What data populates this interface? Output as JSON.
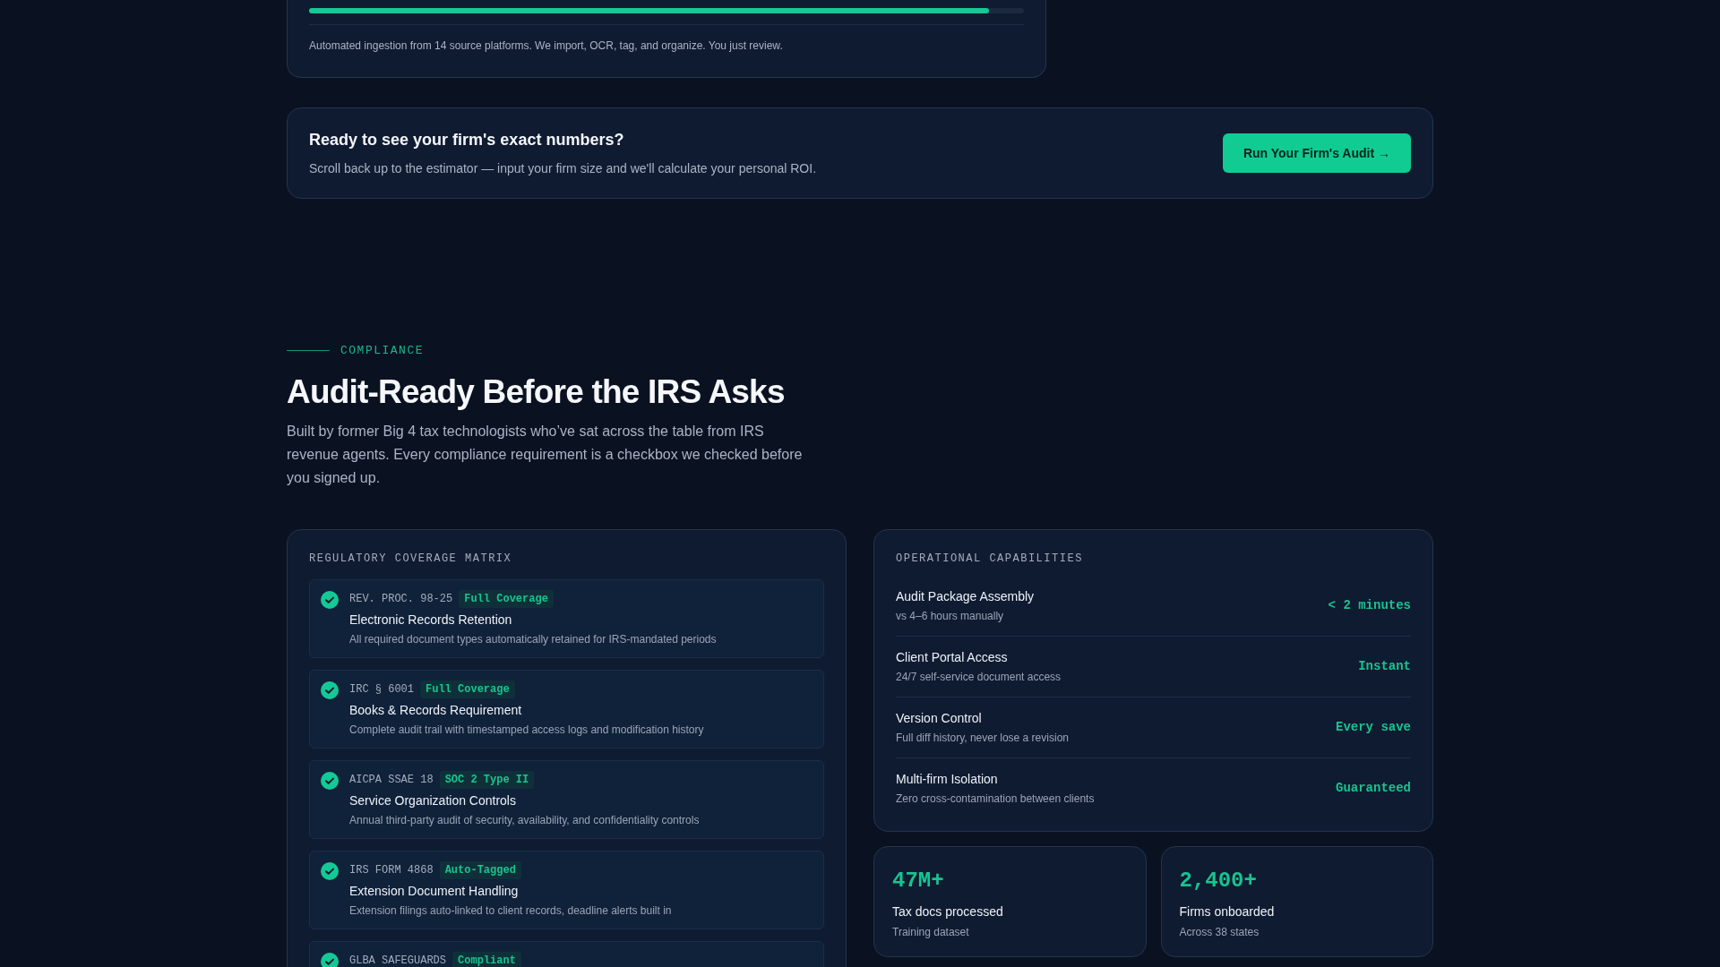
{
  "ingestion_card": {
    "progress": {
      "level": 0.951
    },
    "note": "Automated ingestion from 14 source platforms. We import, OCR, tag, and organize. You just review."
  },
  "cta": {
    "title": "Ready to see your firm's exact numbers?",
    "text": "Scroll back up to the estimator — input your firm size and we'll calculate your personal ROI.",
    "button": "Run Your Firm's Audit →"
  },
  "section": {
    "eyebrow": "COMPLIANCE",
    "title": "Audit-Ready Before the IRS Asks",
    "intro": "Built by former Big 4 tax technologists who’ve sat across the table from IRS revenue agents. Every compliance requirement is a checkbox we checked before you signed up."
  },
  "matrix": {
    "title": "REGULATORY COVERAGE MATRIX",
    "items": [
      {
        "code": "REV. PROC. 98-25",
        "badge": "Full Coverage",
        "checked": true,
        "title": "Electronic Records Retention",
        "text": "All required document types automatically retained for IRS-mandated periods"
      },
      {
        "code": "IRC § 6001",
        "badge": "Full Coverage",
        "checked": true,
        "title": "Books & Records Requirement",
        "text": "Complete audit trail with timestamped access logs and modification history"
      },
      {
        "code": "AICPA SSAE 18",
        "badge": "SOC 2 Type II",
        "checked": true,
        "title": "Service Organization Controls",
        "text": "Annual third-party audit of security, availability, and confidentiality controls"
      },
      {
        "code": "IRS FORM 4868",
        "badge": "Auto-Tagged",
        "checked": true,
        "title": "Extension Document Handling",
        "text": "Extension filings auto-linked to client records, deadline alerts built in"
      },
      {
        "code": "GLBA SAFEGUARDS",
        "badge": "Compliant",
        "checked": true
      }
    ]
  },
  "capabilities": {
    "title": "OPERATIONAL CAPABILITIES",
    "rows": [
      {
        "name": "Audit Package Assembly",
        "detail": "vs 4–6 hours manually",
        "value": "< 2 minutes"
      },
      {
        "name": "Client Portal Access",
        "detail": "24/7 self-service document access",
        "value": "Instant"
      },
      {
        "name": "Version Control",
        "detail": "Full diff history, never lose a revision",
        "value": "Every save"
      },
      {
        "name": "Multi-firm Isolation",
        "detail": "Zero cross-contamination between clients",
        "value": "Guaranteed"
      }
    ]
  },
  "stats": [
    {
      "value": "47M+",
      "label": "Tax docs processed",
      "sub": "Training dataset"
    },
    {
      "value": "2,400+",
      "label": "Firms onboarded",
      "sub": "Across 38 states"
    }
  ]
}
